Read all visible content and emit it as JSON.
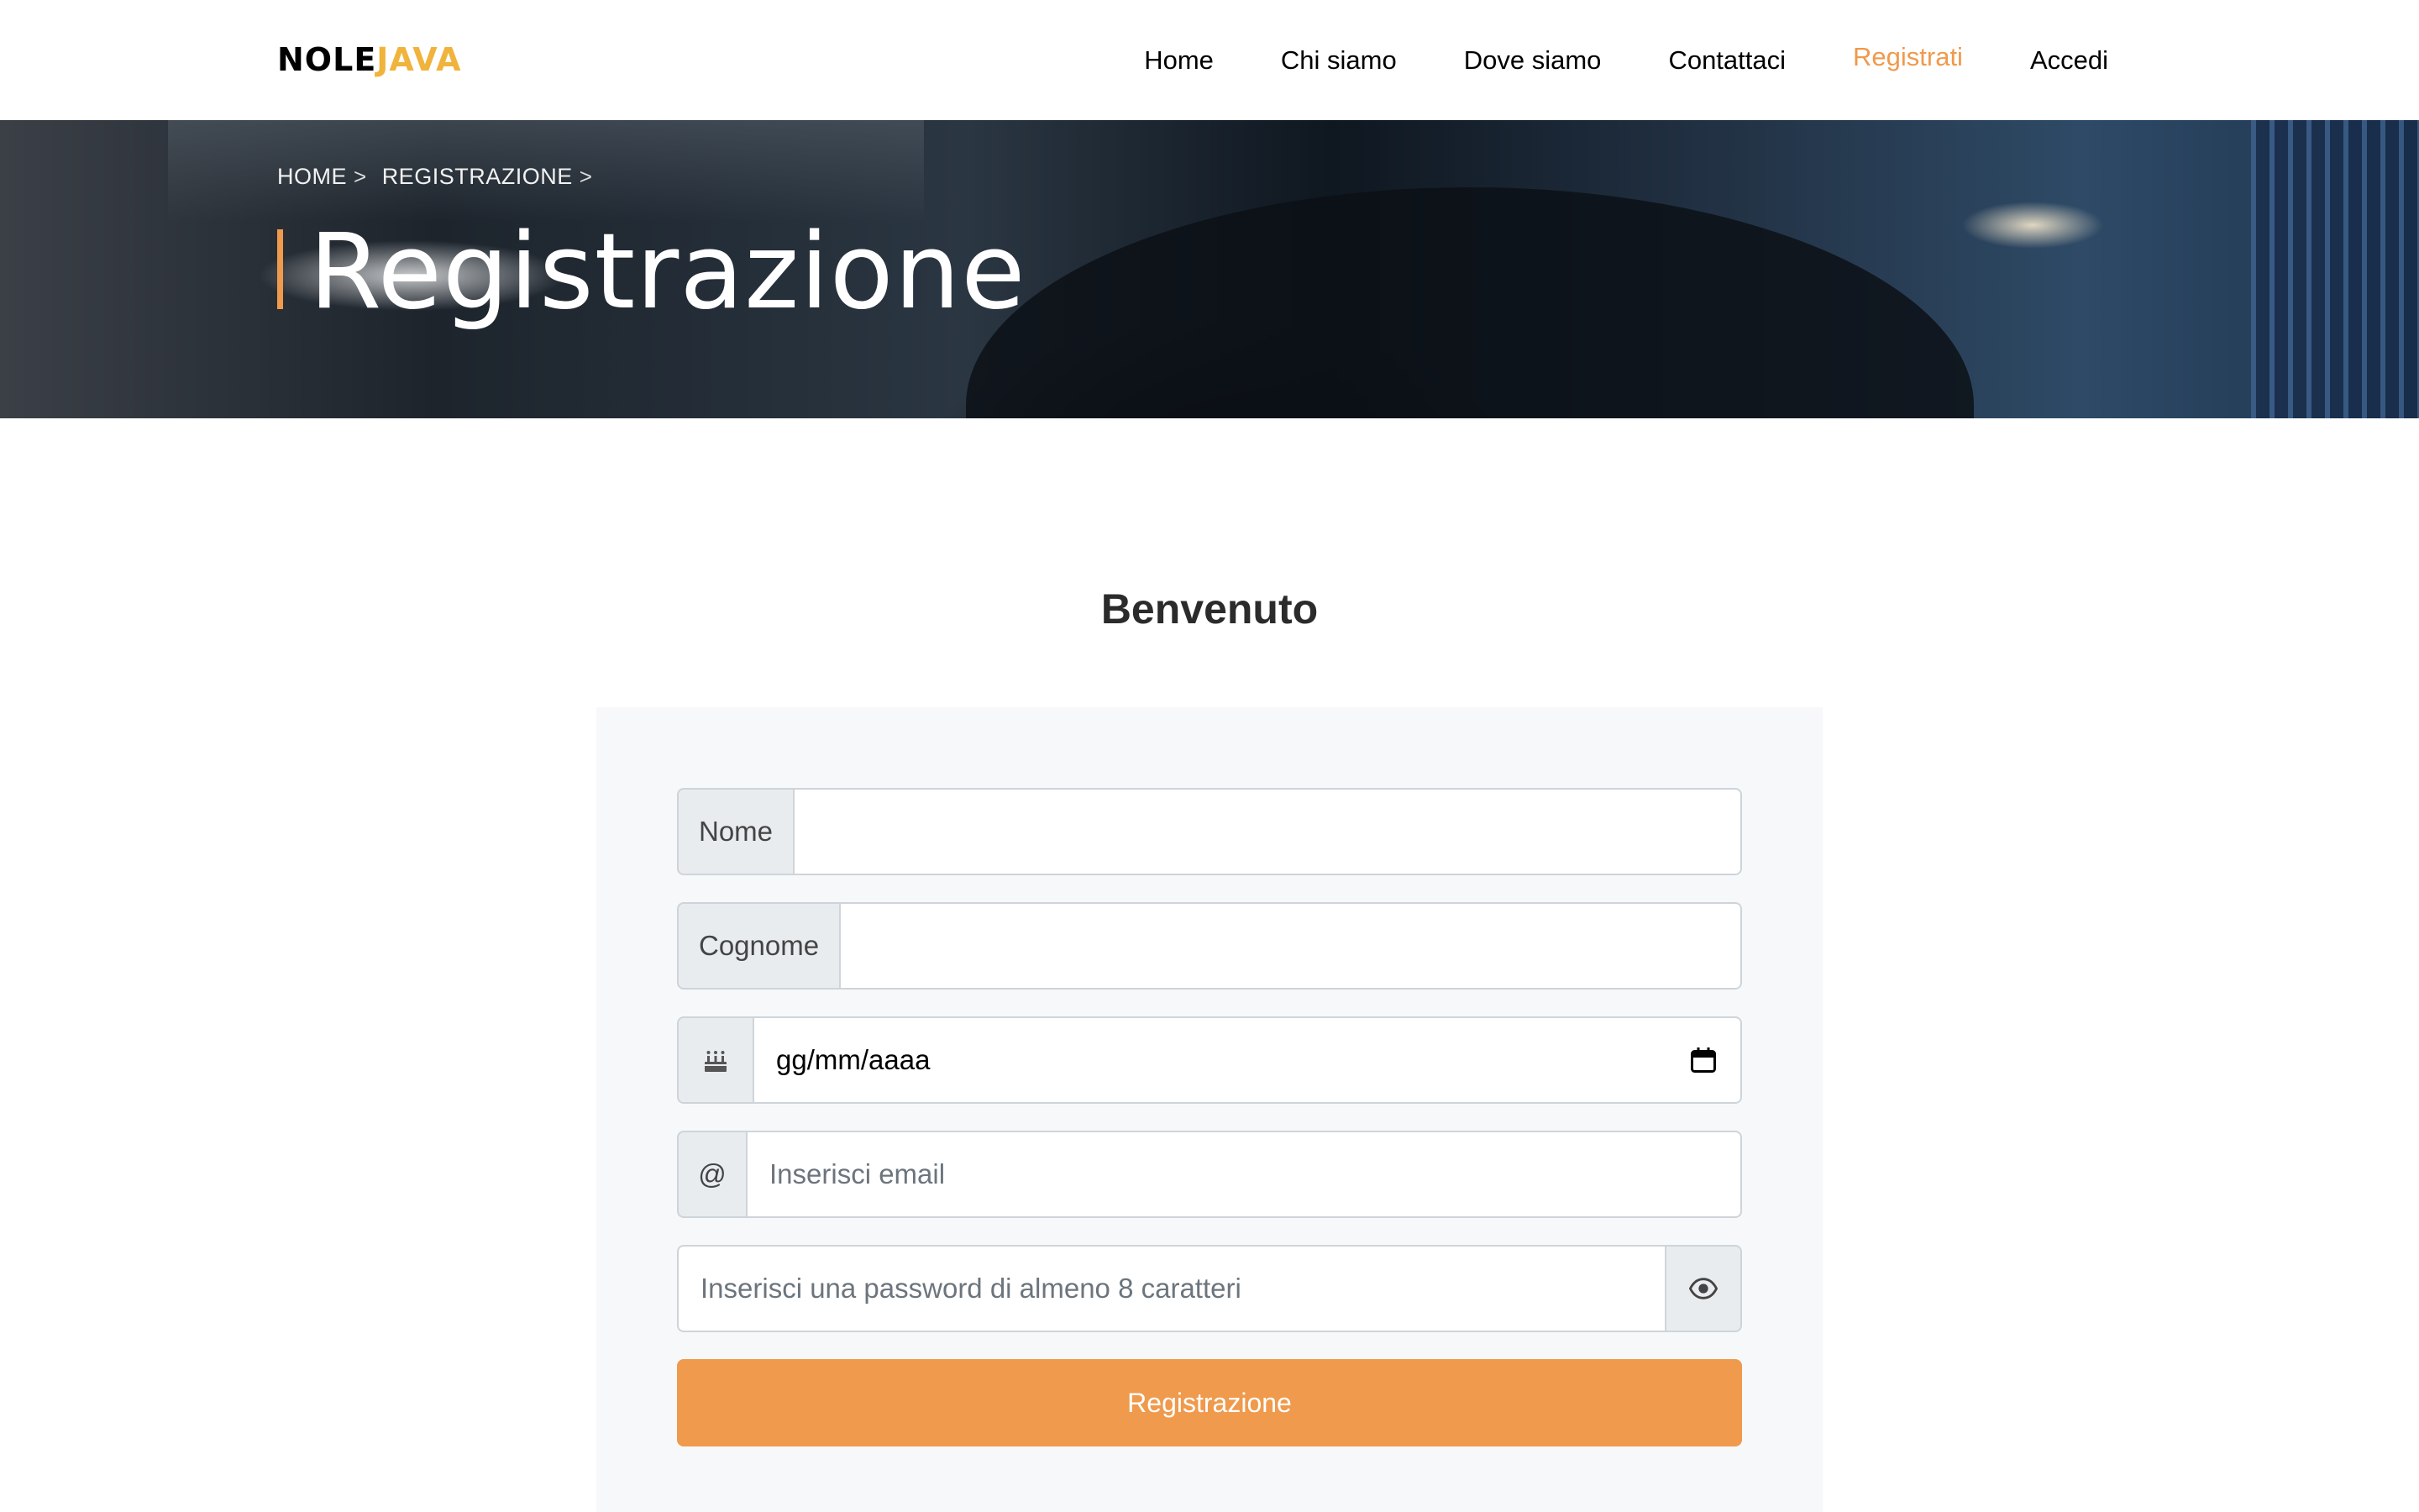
{
  "brand": {
    "part1": "NOLE",
    "part2": "JAVA",
    "color_part2": "#f0b33b"
  },
  "nav": {
    "items": [
      {
        "label": "Home"
      },
      {
        "label": "Chi siamo"
      },
      {
        "label": "Dove siamo"
      },
      {
        "label": "Contattaci"
      },
      {
        "label": "Registrati",
        "active": true
      },
      {
        "label": "Accedi"
      }
    ],
    "active_color": "#ef9a4c"
  },
  "hero": {
    "breadcrumb": [
      "HOME",
      "REGISTRAZIONE"
    ],
    "breadcrumb_separator": ">",
    "title": "Registrazione"
  },
  "welcome": "Benvenuto",
  "form": {
    "nome_label": "Nome",
    "nome_value": "",
    "cognome_label": "Cognome",
    "cognome_value": "",
    "birthdate_icon": "birthday-cake-icon",
    "birthdate_value": "gg/mm/aaaa",
    "email_addon": "@",
    "email_placeholder": "Inserisci email",
    "password_placeholder": "Inserisci una password di almeno 8 caratteri",
    "password_toggle_icon": "eye-icon",
    "submit_label": "Registrazione",
    "accent_color": "#ef9a4c"
  }
}
